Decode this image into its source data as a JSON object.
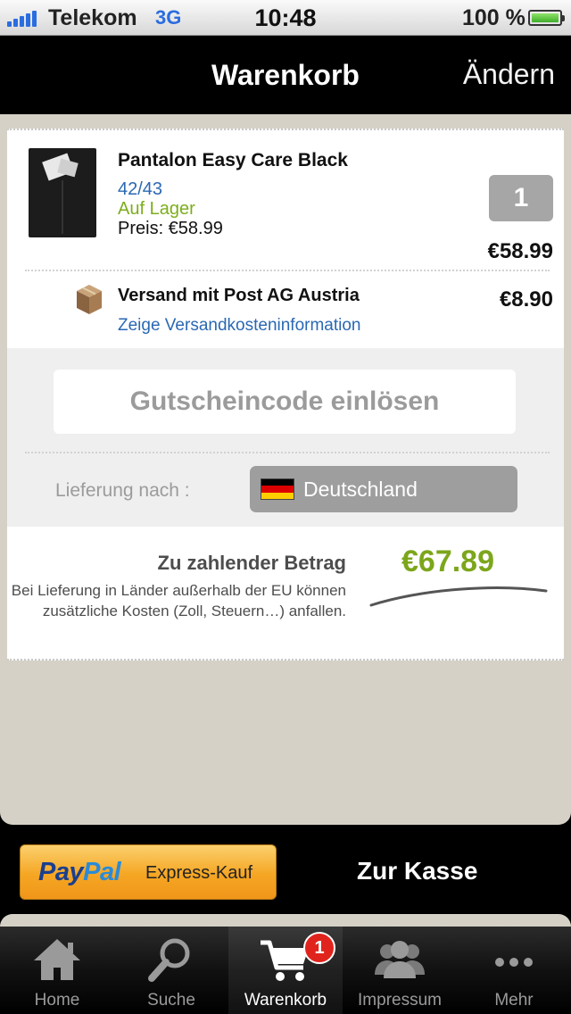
{
  "status_bar": {
    "carrier": "Telekom",
    "network": "3G",
    "time": "10:48",
    "battery": "100 %"
  },
  "nav": {
    "title": "Warenkorb",
    "edit_label": "Ändern"
  },
  "cart": {
    "items": [
      {
        "name": "Pantalon Easy Care Black",
        "size": "42/43",
        "stock": "Auf Lager",
        "price": "Preis: €58.99",
        "quantity": "1",
        "total": "€58.99"
      }
    ],
    "shipping": {
      "name": "Versand mit Post AG Austria",
      "info_link": "Zeige Versandkosteninformation",
      "price": "€8.90",
      "icon": "package-box-icon"
    },
    "voucher_label": "Gutscheincode einlösen",
    "delivery": {
      "label": "Lieferung nach :",
      "country": "Deutschland",
      "flag_colors": [
        "#000000",
        "#dd0000",
        "#ffce00"
      ]
    },
    "total": {
      "label": "Zu zahlender Betrag",
      "note": "Bei Lieferung in Länder außerhalb der EU können zusätzliche Kosten (Zoll, Steuern…) anfallen.",
      "amount": "€67.89",
      "color": "#7ca61b"
    }
  },
  "checkout": {
    "paypal_part1": "Pay",
    "paypal_part2": "Pal",
    "paypal_express": "Express-Kauf",
    "checkout_label": "Zur Kasse"
  },
  "tabbar": {
    "tabs": [
      {
        "label": "Home",
        "icon": "home-icon"
      },
      {
        "label": "Suche",
        "icon": "search-icon"
      },
      {
        "label": "Warenkorb",
        "icon": "cart-icon",
        "badge": "1",
        "active": true
      },
      {
        "label": "Impressum",
        "icon": "people-icon"
      },
      {
        "label": "Mehr",
        "icon": "more-icon"
      }
    ]
  }
}
